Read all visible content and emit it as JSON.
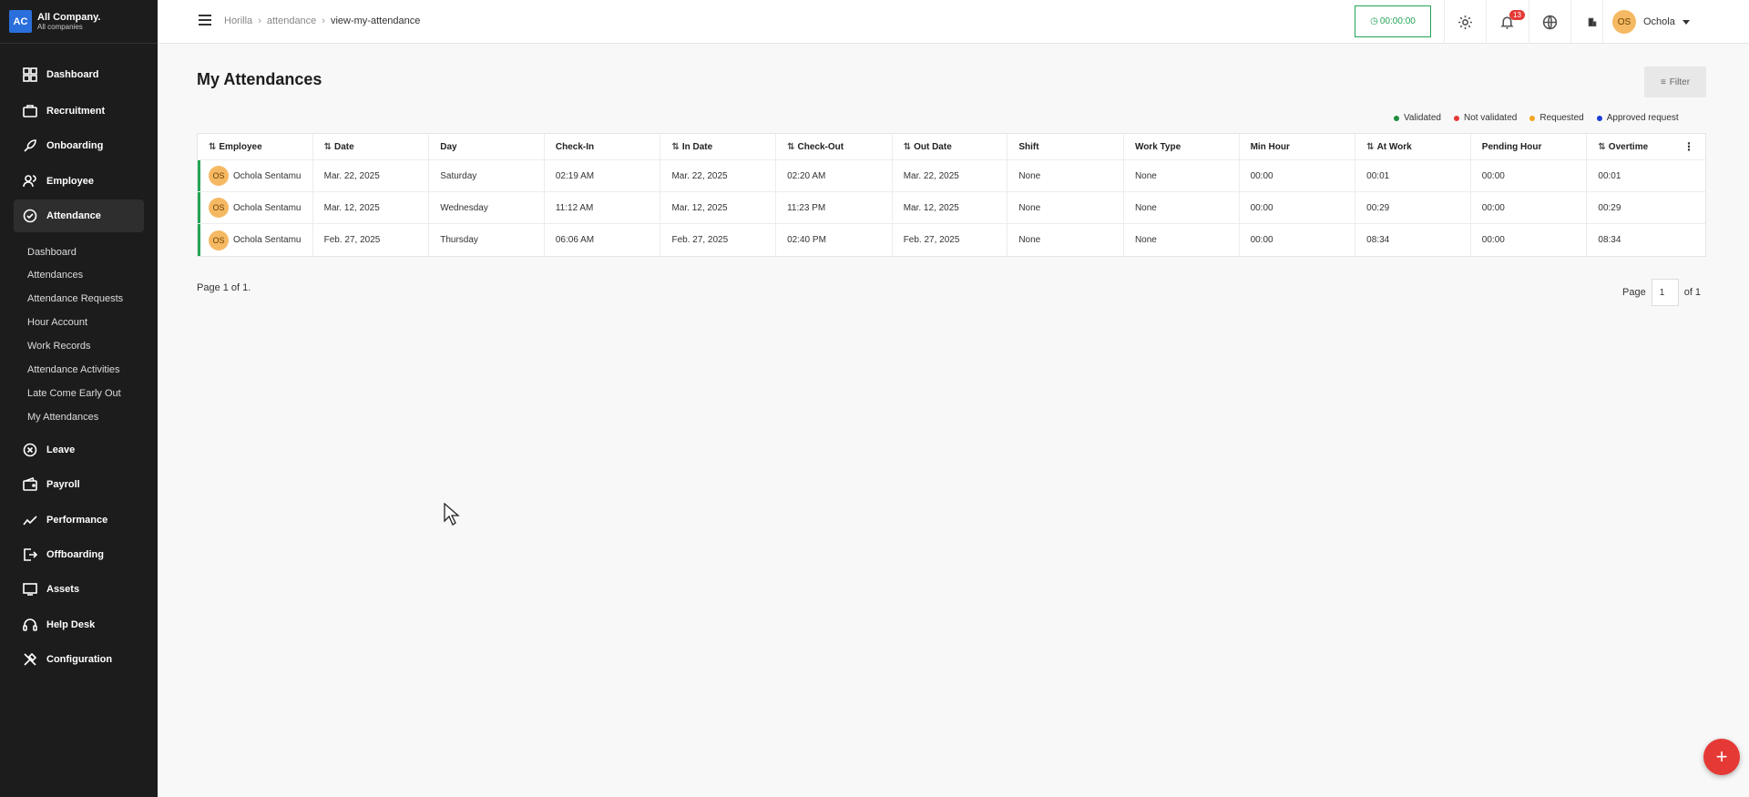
{
  "company": {
    "logo": "AC",
    "name": "All Company.",
    "sub": "All companies"
  },
  "sidebar": {
    "items": [
      {
        "label": "Dashboard",
        "icon": "dashboard-icon"
      },
      {
        "label": "Recruitment",
        "icon": "recruitment-icon"
      },
      {
        "label": "Onboarding",
        "icon": "onboarding-icon"
      },
      {
        "label": "Employee",
        "icon": "employee-icon"
      },
      {
        "label": "Attendance",
        "icon": "attendance-icon"
      },
      {
        "label": "Leave",
        "icon": "leave-icon"
      },
      {
        "label": "Payroll",
        "icon": "payroll-icon"
      },
      {
        "label": "Performance",
        "icon": "performance-icon"
      },
      {
        "label": "Offboarding",
        "icon": "offboarding-icon"
      },
      {
        "label": "Assets",
        "icon": "assets-icon"
      },
      {
        "label": "Help Desk",
        "icon": "helpdesk-icon"
      },
      {
        "label": "Configuration",
        "icon": "configuration-icon"
      }
    ],
    "attendance_sub": [
      "Dashboard",
      "Attendances",
      "Attendance Requests",
      "Hour Account",
      "Work Records",
      "Attendance Activities",
      "Late Come Early Out",
      "My Attendances"
    ]
  },
  "topbar": {
    "breadcrumb": [
      "Horilla",
      "attendance",
      "view-my-attendance"
    ],
    "timer": "00:00:00",
    "notif_count": "13",
    "user_initials": "OS",
    "user_name": "Ochola"
  },
  "page": {
    "title": "My Attendances",
    "filter_label": "Filter",
    "legend": [
      {
        "label": "Validated",
        "color": "#1e8e3e"
      },
      {
        "label": "Not validated",
        "color": "#e53935"
      },
      {
        "label": "Requested",
        "color": "#f5a623"
      },
      {
        "label": "Approved request",
        "color": "#1a3fd6"
      }
    ],
    "page_info": "Page 1 of 1.",
    "pager": {
      "label": "Page",
      "value": "1",
      "of": "of 1"
    },
    "fab": "+"
  },
  "table": {
    "headers": [
      "Employee",
      "Date",
      "Day",
      "Check-In",
      "In Date",
      "Check-Out",
      "Out Date",
      "Shift",
      "Work Type",
      "Min Hour",
      "At Work",
      "Pending Hour",
      "Overtime"
    ],
    "rows": [
      {
        "initials": "OS",
        "employee": "Ochola Sentamu",
        "date": "Mar. 22, 2025",
        "day": "Saturday",
        "check_in": "02:19 AM",
        "in_date": "Mar. 22, 2025",
        "check_out": "02:20 AM",
        "out_date": "Mar. 22, 2025",
        "shift": "None",
        "work_type": "None",
        "min_hour": "00:00",
        "at_work": "00:01",
        "pending": "00:00",
        "overtime": "00:01"
      },
      {
        "initials": "OS",
        "employee": "Ochola Sentamu",
        "date": "Mar. 12, 2025",
        "day": "Wednesday",
        "check_in": "11:12 AM",
        "in_date": "Mar. 12, 2025",
        "check_out": "11:23 PM",
        "out_date": "Mar. 12, 2025",
        "shift": "None",
        "work_type": "None",
        "min_hour": "00:00",
        "at_work": "00:29",
        "pending": "00:00",
        "overtime": "00:29"
      },
      {
        "initials": "OS",
        "employee": "Ochola Sentamu",
        "date": "Feb. 27, 2025",
        "day": "Thursday",
        "check_in": "06:06 AM",
        "in_date": "Feb. 27, 2025",
        "check_out": "02:40 PM",
        "out_date": "Feb. 27, 2025",
        "shift": "None",
        "work_type": "None",
        "min_hour": "00:00",
        "at_work": "08:34",
        "pending": "00:00",
        "overtime": "08:34"
      }
    ]
  }
}
